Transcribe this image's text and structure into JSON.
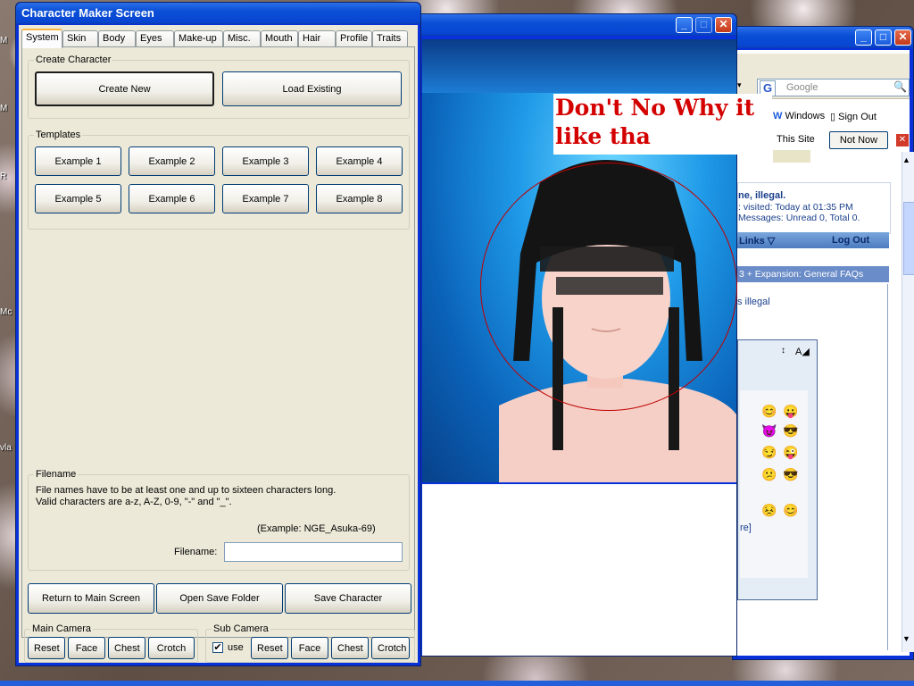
{
  "desktop": {
    "icon_labels": [
      "M",
      "M",
      "R",
      "Mc",
      "vla"
    ]
  },
  "browser": {
    "google_placeholder": "Google",
    "windows_link": "Windows",
    "signout_link": "Sign Out",
    "this_site_btn": "This Site",
    "not_now_btn": "Not Now",
    "welcome_text": "ne, illegal.",
    "last_visited": ": visited: Today at 01:35 PM",
    "messages": "Messages: Unread 0, Total 0.",
    "links_label": "Links",
    "logout_label": "Log Out",
    "breadcrumb": "3 + Expansion: General FAQs",
    "sidebar_user": "s illegal",
    "more_link": "re]"
  },
  "annotation": {
    "line1": "Don't No Why it",
    "line2": "like tha"
  },
  "maker": {
    "title": "Character Maker Screen",
    "tabs": [
      "System",
      "Skin",
      "Body",
      "Eyes",
      "Make-up",
      "Misc.",
      "Mouth",
      "Hair",
      "Profile",
      "Traits"
    ],
    "create_group": "Create Character",
    "create_new": "Create New",
    "load_existing": "Load Existing",
    "templates_group": "Templates",
    "templates": [
      "Example 1",
      "Example 2",
      "Example 3",
      "Example 4",
      "Example 5",
      "Example 6",
      "Example 7",
      "Example 8"
    ],
    "filename_group": "Filename",
    "filename_help1": "File names have to be at least one and up to sixteen characters long.",
    "filename_help2": "Valid characters are a-z, A-Z, 0-9, \"-\" and \"_\".",
    "filename_example": "(Example: NGE_Asuka-69)",
    "filename_label": "Filename:",
    "filename_value": "",
    "return_btn": "Return to Main Screen",
    "open_folder_btn": "Open Save Folder",
    "save_btn": "Save Character",
    "main_camera": "Main Camera",
    "sub_camera": "Sub Camera",
    "use_label": "use",
    "use_checked": "✔",
    "cam_reset": "Reset",
    "cam_face": "Face",
    "cam_chest": "Chest",
    "cam_crotch": "Crotch"
  }
}
